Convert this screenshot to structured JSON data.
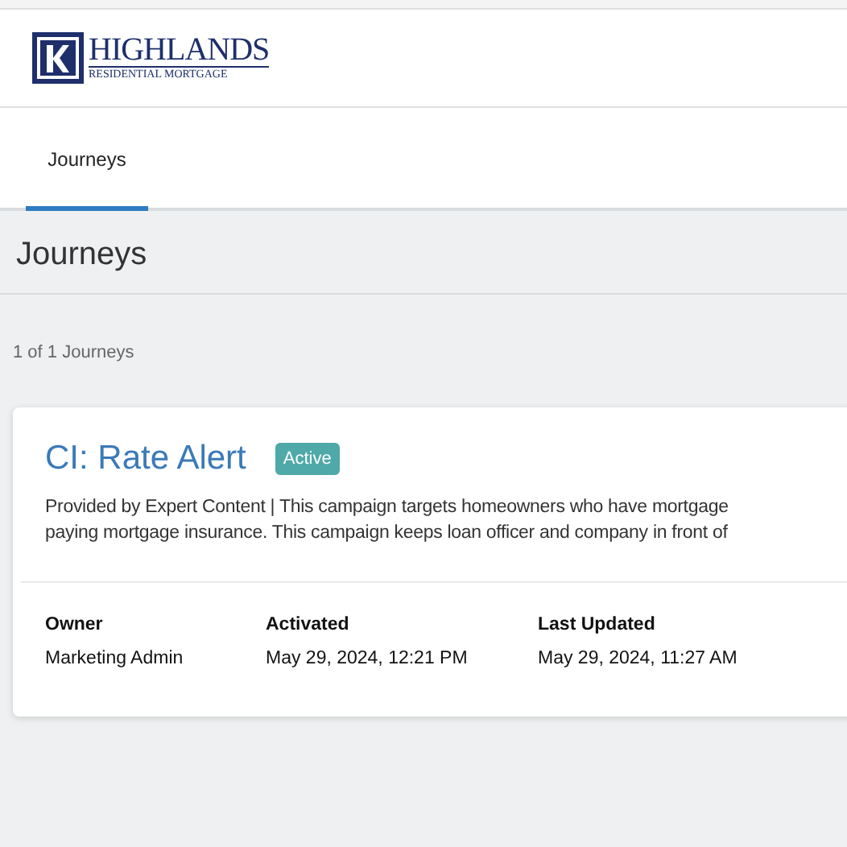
{
  "logo": {
    "name": "HIGHLANDS",
    "tagline": "RESIDENTIAL MORTGAGE"
  },
  "tabs": [
    {
      "label": "Journeys",
      "selected": true
    }
  ],
  "page_title": "Journeys",
  "count": "1 of 1 Journeys",
  "journeys": [
    {
      "title": "CI: Rate Alert",
      "status": "Active",
      "description_lines": [
        "Provided by Expert Content | This campaign targets homeowners who have mortgage",
        "paying mortgage insurance. This campaign keeps loan officer and company in front of"
      ],
      "fields": [
        {
          "label": "Owner",
          "value": "Marketing Admin"
        },
        {
          "label": "Activated",
          "value": "May 29, 2024, 12:21 PM"
        },
        {
          "label": "Last Updated",
          "value": "May 29, 2024, 11:27 AM"
        }
      ]
    }
  ]
}
